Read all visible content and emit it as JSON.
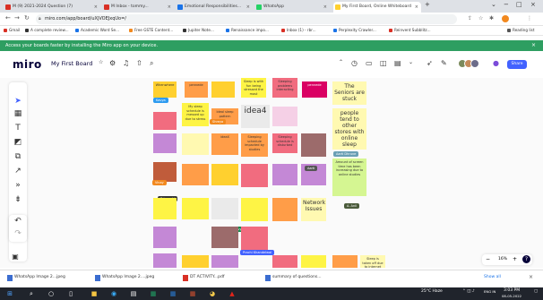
{
  "browser": {
    "tabs": [
      {
        "label": "M (9) 2021-2024 Question (7)",
        "favicon": "gmail-icon",
        "color": "#d93025"
      },
      {
        "label": "M Inbox - tommy...",
        "favicon": "gmail-icon",
        "color": "#d93025"
      },
      {
        "label": "Emotional Responsibilities...",
        "favicon": "doc-icon",
        "color": "#1a73e8"
      },
      {
        "label": "WhatsApp",
        "favicon": "whatsapp-icon",
        "color": "#25d366"
      },
      {
        "label": "My First Board, Online Whiteboard",
        "favicon": "miro-icon",
        "color": "#ffd02f"
      }
    ],
    "url": "miro.com/app/board/uXjVOEJxqUo=/",
    "bookmarks": [
      {
        "label": "Gmail",
        "color": "#d93025"
      },
      {
        "label": "A complete review...",
        "color": "#333333"
      },
      {
        "label": "Academic Word Se...",
        "color": "#1a73e8"
      },
      {
        "label": "Free GSTE Content...",
        "color": "#f2891f"
      },
      {
        "label": "Jupiter Note...",
        "color": "#333333"
      },
      {
        "label": "Renaissance impo...",
        "color": "#1a73e8"
      },
      {
        "label": "Inbox (1) - rbr...",
        "color": "#d93025"
      },
      {
        "label": "Perplexity Crawler...",
        "color": "#1a73e8"
      },
      {
        "label": "Reinvent Subblitz...",
        "color": "#d93025"
      },
      {
        "label": "Reading list",
        "color": "#555555"
      }
    ]
  },
  "banner": {
    "text": "Access your boards faster by installing the Miro app on your device."
  },
  "miro": {
    "logo": "miro",
    "board_name": "My First Board",
    "share_label": "Share",
    "zoom_minus": "−",
    "zoom_value": "16%",
    "zoom_plus": "+",
    "help": "?"
  },
  "notes": [
    {
      "text": "Whenwhere",
      "color": "#ffd02f"
    },
    {
      "text": "pennede",
      "color": "#ff9d48"
    },
    {
      "text": "Sleep is with fun being stressed the most",
      "color": "#fef445"
    },
    {
      "text": "Sleeping problems interacting",
      "color": "#f16c7f"
    },
    {
      "text": "pennede",
      "color": "#da0063"
    },
    {
      "text": "The Seniors are stuck",
      "color": "#fff9b1"
    },
    {
      "text": "My sleep schedule is messed up due to stress",
      "color": "#ff9d48"
    },
    {
      "text": "Ideal sleep pattern",
      "color": "#ff9d48"
    },
    {
      "text": "idea4",
      "color": "#eaeaea"
    },
    {
      "text": "people tend to other stores with online sleep",
      "color": "#fff9b1"
    },
    {
      "text": "ideaX",
      "color": "#ff9d48"
    },
    {
      "text": "Sleeping schedule impacted by studies",
      "color": "#ff9d48"
    },
    {
      "text": "Sleeping schedule is disturbed",
      "color": "#f16c7f"
    },
    {
      "text": "Amount of screen time has been increasing due to online studies",
      "color": "#d5f692"
    },
    {
      "text": "Network Issues",
      "color": "#fff9b1"
    },
    {
      "text": "Sleep is taken off due to internet lag",
      "color": "#ff9d48"
    }
  ],
  "cursors": [
    {
      "text": "Kavya",
      "color": "#2d9bf0"
    },
    {
      "text": "Shreya",
      "color": "#f2891f"
    },
    {
      "text": "Aarti Dhruve",
      "color": "#6a9fb5"
    },
    {
      "text": "Vinay",
      "color": "#555555"
    },
    {
      "text": "Priyanshi",
      "color": "#333333"
    },
    {
      "text": "Kavya Gupta",
      "color": "#1b8b4b"
    },
    {
      "text": "Aarti",
      "color": "#555555"
    },
    {
      "text": "Prachi Khandelwal",
      "color": "#4262ff"
    },
    {
      "text": "A. Anil",
      "color": "#4b5b3b"
    }
  ],
  "downloads": [
    {
      "label": "WhatsApp Image 2...jpeg"
    },
    {
      "label": "WhatsApp Image 2....jpeg"
    },
    {
      "label": "DT ACTIVITY...pdf"
    },
    {
      "label": "summary of questions..."
    }
  ],
  "downloads_show_all": "Show all",
  "taskbar": {
    "weather": "25°C Haze",
    "time": "3:03 PM",
    "date": "08-05-2022",
    "lang": "ENG IN"
  }
}
